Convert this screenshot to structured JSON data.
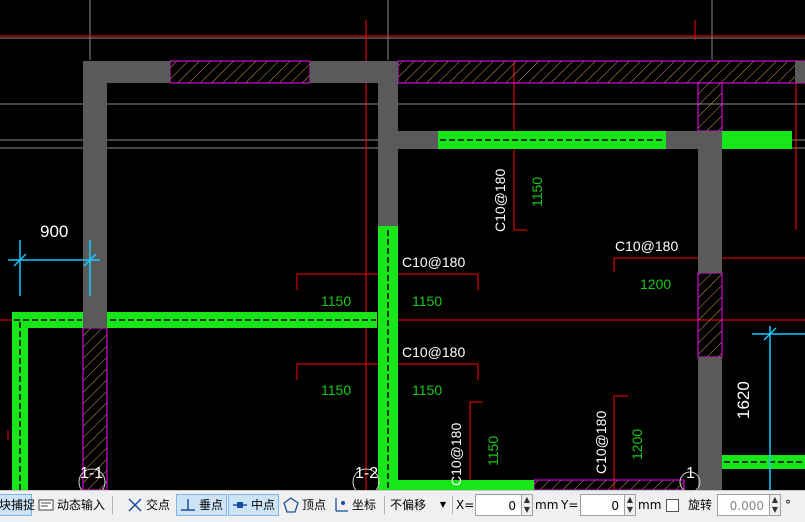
{
  "drawing": {
    "dimension_left": "900",
    "dimension_right": "1620",
    "rebar_labels": [
      "C10@180",
      "C10@180",
      "C10@180",
      "C10@180",
      "C10@180",
      "C10@180"
    ],
    "green_values": [
      "1150",
      "1150",
      "1150",
      "1150",
      "1200",
      "1150",
      "1200"
    ],
    "axis_labels": [
      "1-1",
      "1-2",
      "1"
    ]
  },
  "statusbar": {
    "snap_label": "块捕捉",
    "dynamic_input_label": "动态输入",
    "intersection_label": "交点",
    "perpendicular_label": "垂点",
    "midpoint_label": "中点",
    "vertex_label": "顶点",
    "coordinate_label": "坐标",
    "offset_select": "不偏移",
    "x_label": "X=",
    "x_value": "0",
    "x_unit": "mm",
    "y_label": "Y=",
    "y_value": "0",
    "y_unit": "mm",
    "rotate_label": "旋转",
    "rotate_value": "0.000",
    "degree": "°"
  },
  "colors": {
    "background": "#000000",
    "wall": "#5a5a5a",
    "rebar": "#19e619",
    "hatch": "#ff00ff",
    "guide": "#ff0000",
    "dimension": "#19c8ff",
    "text": "#ffffff",
    "value_text": "#19c819"
  }
}
